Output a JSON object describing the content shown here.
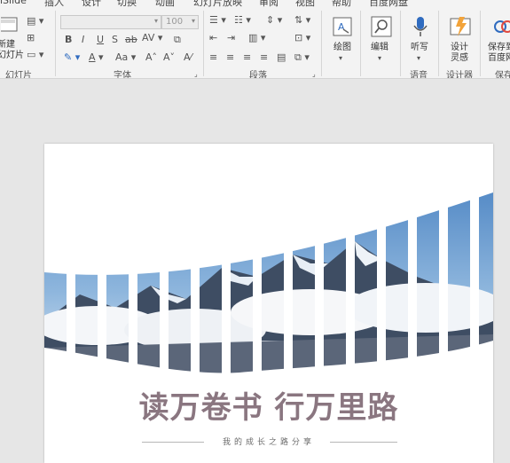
{
  "tabs": [
    "iSlide",
    "插入",
    "设计",
    "切换",
    "动画",
    "幻灯片放映",
    "审阅",
    "视图",
    "帮助",
    "百度网盘"
  ],
  "ribbon": {
    "slides_group": {
      "new_slide_label": "新建\n幻灯片",
      "group_label": "幻灯片"
    },
    "font_group": {
      "font_name_placeholder": "",
      "font_size": "100",
      "group_label": "字体"
    },
    "paragraph_group": {
      "group_label": "段落"
    },
    "drawing": {
      "label": "绘图"
    },
    "editing": {
      "label": "编辑"
    },
    "dictate": {
      "label": "听写",
      "group_label": "语音"
    },
    "designer": {
      "label": "设计\n灵感",
      "group_label": "设计器"
    },
    "save": {
      "label": "保存到\n百度网",
      "group_label": "保存"
    }
  },
  "slide": {
    "title": "读万卷书 行万里路",
    "subtitle": "我的成长之路分享"
  },
  "colors": {
    "title": "#8a7680",
    "ribbon_bg": "#f3f3f3",
    "canvas_bg": "#e6e6e6",
    "accent_blue": "#2f6bbf"
  }
}
